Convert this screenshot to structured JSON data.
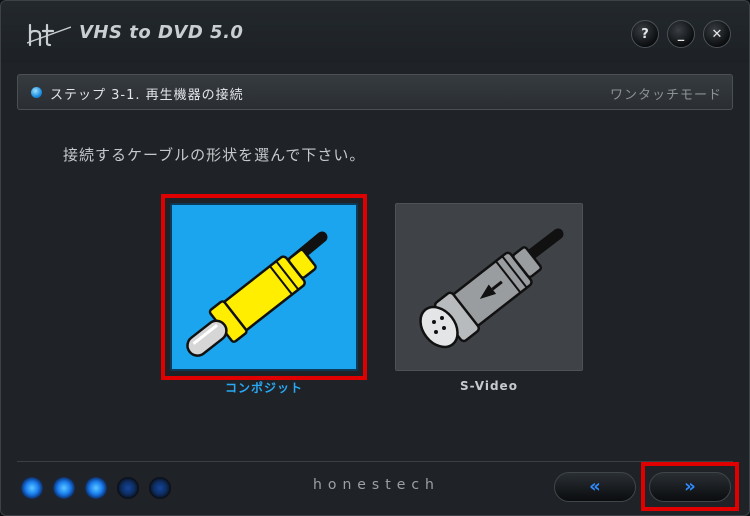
{
  "window": {
    "title": "VHS to DVD 5.0",
    "logo_text": "ht",
    "buttons": [
      {
        "name": "help",
        "label": "?"
      },
      {
        "name": "minimize",
        "label": "_"
      },
      {
        "name": "close",
        "label": "✕"
      }
    ]
  },
  "step_bar": {
    "step_label": "ステップ 3-1. 再生機器の接続",
    "mode_label": "ワンタッチモード"
  },
  "instruction": "接続するケーブルの形状を選んで下さい。",
  "options": [
    {
      "id": "composite",
      "label": "コンポジット",
      "selected": true,
      "icon": "rca-composite-plug-icon"
    },
    {
      "id": "svideo",
      "label": "S-Video",
      "selected": false,
      "icon": "s-video-plug-icon"
    }
  ],
  "footer": {
    "brand": "honestech",
    "progress_steps_total": 5,
    "progress_steps_lit": 3,
    "back_icon": "«",
    "next_icon": "»"
  },
  "colors": {
    "accent": "#1aa5ee",
    "label_selected": "#29a9f5",
    "highlight": "#e00000",
    "nav_arrow": "#2f8cff"
  }
}
